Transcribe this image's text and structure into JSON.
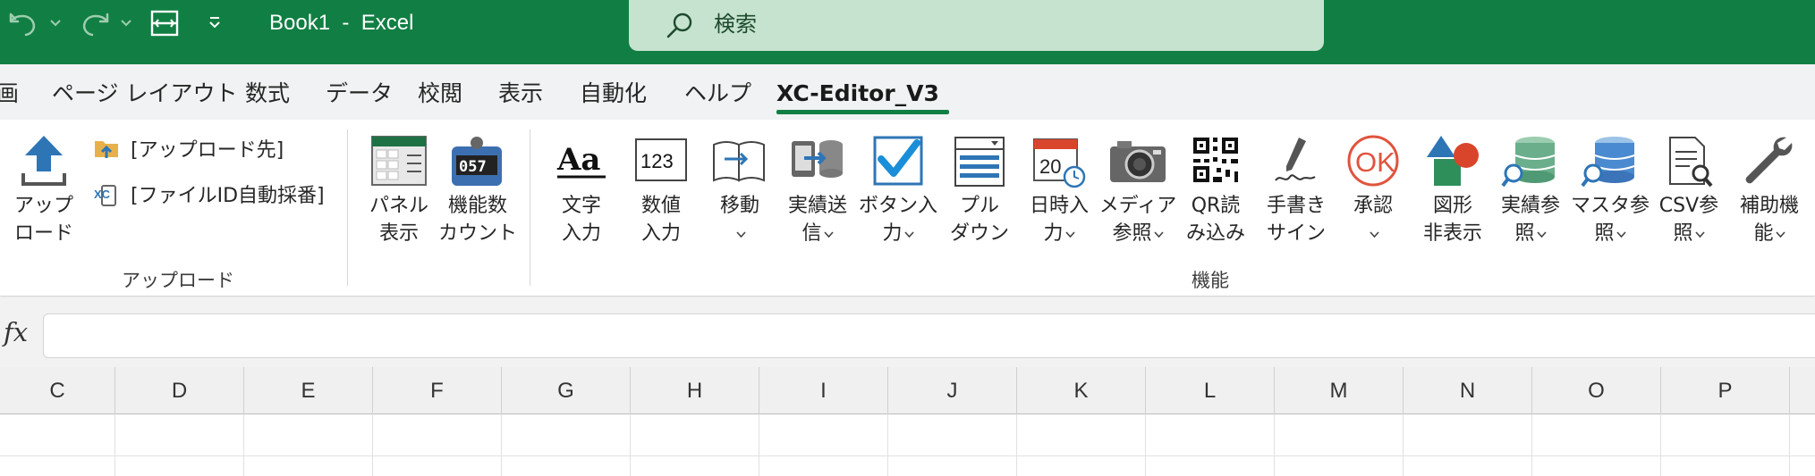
{
  "titlebar": {
    "title": "Book1  -  Excel",
    "search_text": "検索",
    "icons": [
      "undo-icon",
      "redo-icon",
      "form-icon",
      "customize-qat-icon"
    ]
  },
  "tabs": [
    {
      "label": "画",
      "active": false
    },
    {
      "label": "ページ レイアウト",
      "active": false
    },
    {
      "label": "数式",
      "active": false
    },
    {
      "label": "データ",
      "active": false
    },
    {
      "label": "校閲",
      "active": false
    },
    {
      "label": "表示",
      "active": false
    },
    {
      "label": "自動化",
      "active": false
    },
    {
      "label": "ヘルプ",
      "active": false
    },
    {
      "label": "XC-Editor_V3",
      "active": true
    }
  ],
  "ribbon": {
    "upload_group": {
      "upload_button": "アップ\nロード",
      "upload_dest": "[アップロード先]",
      "file_id": "[ファイルID自動採番]",
      "group_label": "アップロード"
    },
    "panel_buttons": [
      {
        "label": "パネル\n表示",
        "icon": "panel-icon"
      },
      {
        "label": "機能数\nカウント",
        "icon": "counter-icon"
      }
    ],
    "function_buttons": [
      {
        "label": "文字\n入力",
        "icon": "text-input-icon",
        "dropdown": false
      },
      {
        "label": "数値\n入力",
        "icon": "number-input-icon",
        "dropdown": false
      },
      {
        "label": "移動",
        "icon": "move-icon",
        "dropdown": true
      },
      {
        "label": "実績送\n信",
        "icon": "send-record-icon",
        "dropdown": true
      },
      {
        "label": "ボタン入\n力",
        "icon": "checkbox-icon",
        "dropdown": true
      },
      {
        "label": "プル\nダウン",
        "icon": "pulldown-icon",
        "dropdown": false
      },
      {
        "label": "日時入\n力",
        "icon": "calendar-icon",
        "dropdown": true
      },
      {
        "label": "メディア\n参照",
        "icon": "camera-icon",
        "dropdown": true
      },
      {
        "label": "QR読\nみ込み",
        "icon": "qr-icon",
        "dropdown": false
      },
      {
        "label": "手書き\nサイン",
        "icon": "pen-icon",
        "dropdown": false
      },
      {
        "label": "承認",
        "icon": "ok-icon",
        "dropdown": true
      },
      {
        "label": "図形\n非表示",
        "icon": "shapes-icon",
        "dropdown": false
      },
      {
        "label": "実績参\n照",
        "icon": "record-db-icon",
        "dropdown": true
      },
      {
        "label": "マスタ参\n照",
        "icon": "master-db-icon",
        "dropdown": true
      },
      {
        "label": "CSV参\n照",
        "icon": "csv-icon",
        "dropdown": true
      },
      {
        "label": "補助機\n能",
        "icon": "wrench-icon",
        "dropdown": true
      }
    ],
    "function_group_label": "機能"
  },
  "formula_bar": {
    "fx_label": "fx",
    "value": ""
  },
  "columns": [
    "C",
    "D",
    "E",
    "F",
    "G",
    "H",
    "I",
    "J",
    "K",
    "L",
    "M",
    "N",
    "O",
    "P"
  ],
  "colors": {
    "excel_green": "#117f43",
    "search_bg": "#c6e3cf",
    "tab_bg": "#f0f2f3"
  }
}
